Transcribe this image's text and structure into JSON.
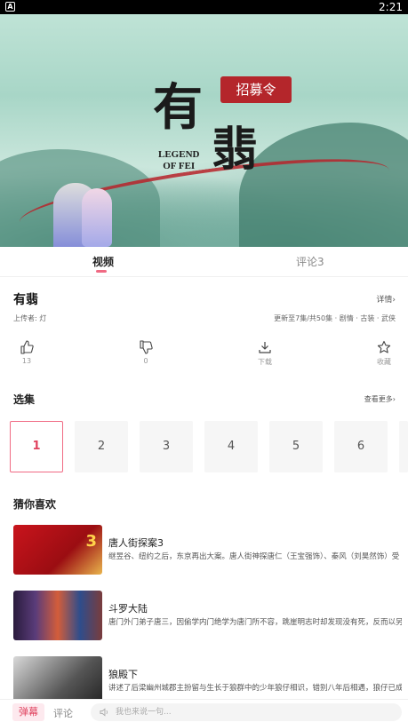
{
  "status_bar": {
    "app_icon": "A",
    "time": "2:21"
  },
  "poster": {
    "title_line1": "有",
    "title_line2": "翡",
    "badge": "招募令",
    "legend_line1": "LEGEND",
    "legend_line2": "OF FEI"
  },
  "tabs": [
    {
      "label": "视频",
      "active": true
    },
    {
      "label": "评论3",
      "active": false
    }
  ],
  "info": {
    "title": "有翡",
    "detail_link": "详情›",
    "uploader": "上传者: 灯",
    "meta": "更新至7集/共50集 · 剧情 · 古装 · 武侠"
  },
  "actions": [
    {
      "icon": "thumbs-up-icon",
      "label": "13"
    },
    {
      "icon": "thumbs-down-icon",
      "label": "0"
    },
    {
      "icon": "download-icon",
      "label": "下载"
    },
    {
      "icon": "star-icon",
      "label": "收藏"
    }
  ],
  "episodes": {
    "title": "选集",
    "more": "查看更多›",
    "items": [
      "1",
      "2",
      "3",
      "4",
      "5",
      "6"
    ],
    "selected": "1"
  },
  "recommend": {
    "title": "猜你喜欢",
    "items": [
      {
        "name": "唐人街探案3",
        "desc": "继昱谷、纽约之后，东京再出大案。唐人街神探唐仁（王宝强饰）、秦风（刘昊然饰）受",
        "thumb_text": "3"
      },
      {
        "name": "斗罗大陆",
        "desc": "唐门外门弟子唐三，因偷学内门绝学为唐门所不容，跳崖明志时却发现没有死，反而以另",
        "thumb_text": ""
      },
      {
        "name": "狼殿下",
        "desc": "讲述了后梁幽州城郡主扮留与生长于狼群中的少年狼仔相识，错别八年后相遇，狼仔已成",
        "thumb_text": ""
      }
    ]
  },
  "bottom_bar": {
    "tab_active": "弹幕",
    "tab": "评论",
    "input_placeholder": "我也来说一句..."
  },
  "colors": {
    "accent": "#e0425e",
    "accent_light": "#fde9ee"
  }
}
